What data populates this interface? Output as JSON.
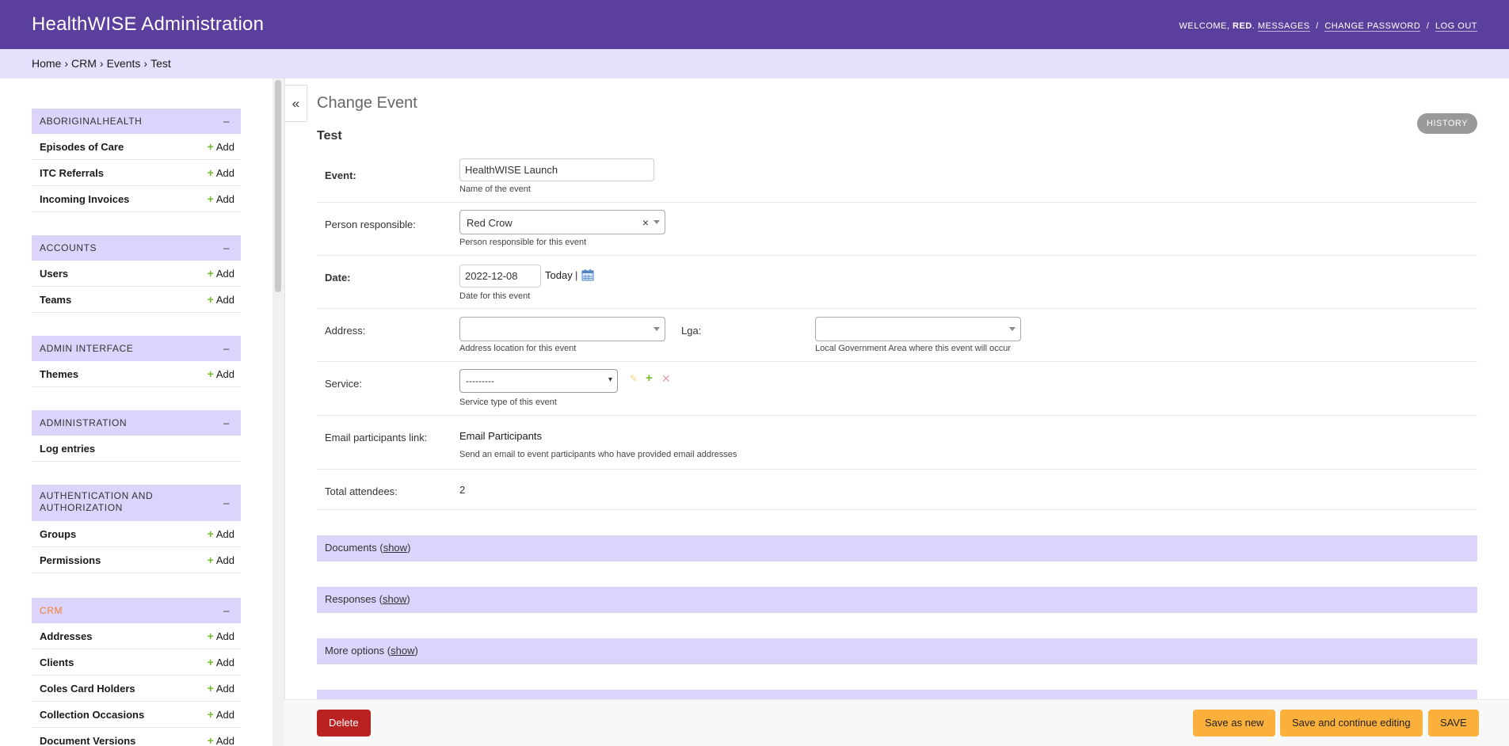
{
  "header": {
    "branding": "HealthWISE Administration",
    "welcome": "WELCOME,",
    "user": "RED",
    "dot": ".",
    "links": [
      "MESSAGES",
      "CHANGE PASSWORD",
      "LOG OUT"
    ],
    "sep": "/"
  },
  "breadcrumbs": [
    "Home",
    "CRM",
    "Events",
    "Test"
  ],
  "breadcrumb_sep": "›",
  "sidebar": {
    "toggle_symbol": "–",
    "add_label": "Add",
    "add_symbol": "+",
    "groups": [
      {
        "name": "ABORIGINALHEALTH",
        "models": [
          "Episodes of Care",
          "ITC Referrals",
          "Incoming Invoices"
        ]
      },
      {
        "name": "ACCOUNTS",
        "models": [
          "Users",
          "Teams"
        ]
      },
      {
        "name": "ADMIN INTERFACE",
        "models": [
          "Themes"
        ]
      },
      {
        "name": "ADMINISTRATION",
        "models": [
          "Log entries"
        ]
      },
      {
        "name": "AUTHENTICATION AND AUTHORIZATION",
        "models": [
          "Groups",
          "Permissions"
        ]
      },
      {
        "name": "CRM",
        "models": [
          "Addresses",
          "Clients",
          "Coles Card Holders",
          "Collection Occasions",
          "Document Versions"
        ]
      }
    ]
  },
  "nav_toggle": "«",
  "content": {
    "page_title": "Change Event",
    "object_title": "Test",
    "history": "HISTORY",
    "fields": {
      "event": {
        "label": "Event:",
        "value": "HealthWISE Launch",
        "help": "Name of the event"
      },
      "person": {
        "label": "Person responsible:",
        "value": "Red Crow",
        "clear": "×",
        "help": "Person responsible for this event"
      },
      "date": {
        "label": "Date:",
        "value": "2022-12-08",
        "today": "Today",
        "sep": "|",
        "help": "Date for this event"
      },
      "address": {
        "label": "Address:",
        "value": "",
        "help": "Address location for this event"
      },
      "lga": {
        "label": "Lga:",
        "value": "",
        "help": "Local Government Area where this event will occur"
      },
      "service": {
        "label": "Service:",
        "value": "---------",
        "help": "Service type of this event"
      },
      "email_link": {
        "label": "Email participants link:",
        "value": "Email Participants",
        "help": "Send an email to event participants who have provided email addresses"
      },
      "total_attendees": {
        "label": "Total attendees:",
        "value": "2"
      }
    },
    "fieldsets": [
      {
        "title": "Documents",
        "show": "show"
      },
      {
        "title": "Responses",
        "show": "show"
      },
      {
        "title": "More options",
        "show": "show"
      }
    ]
  },
  "actions": {
    "delete": "Delete",
    "save_as_new": "Save as new",
    "save_continue": "Save and continue editing",
    "save": "SAVE"
  },
  "colors": {
    "header": "#5b3f9c",
    "breadcrumbs": "#e6e0fc",
    "module_caption": "#dcd4fb",
    "delete": "#ba2121",
    "save": "#fbb03b",
    "add_plus": "#70bf2b",
    "active_group": "#f07f2a"
  }
}
